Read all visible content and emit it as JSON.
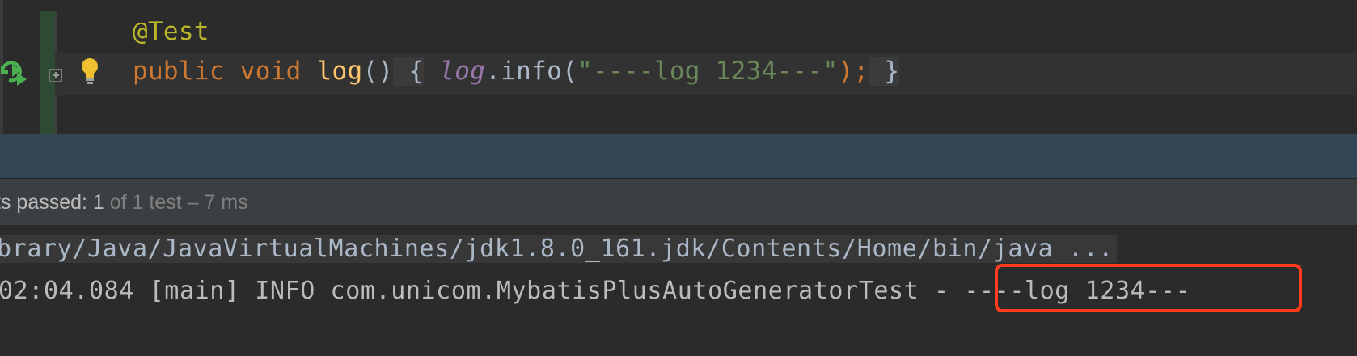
{
  "editor": {
    "annotation": "@Test",
    "method": {
      "kw_public": "public",
      "kw_void": "void",
      "name": "log",
      "parens": "()",
      "open_brace": " {",
      "log_field": "log",
      "call": ".info(",
      "string": "\"----log 1234---\"",
      "close": ");",
      "close_brace": " }"
    }
  },
  "status": {
    "passed_prefix": "ts passed: 1",
    "passed_suffix": " of 1 test – 7 ms"
  },
  "console": {
    "line1": "brary/Java/JavaVirtualMachines/jdk1.8.0_161.jdk/Contents/Home/bin/java ...",
    "line2": "02:04.084 [main] INFO com.unicom.MybatisPlusAutoGeneratorTest - ----log 1234---"
  },
  "colors": {
    "highlight_box": "#ff3b1e",
    "run_icon": "#4caf50",
    "bulb_icon": "#f0c030"
  },
  "icons": [
    "run-test-icon",
    "fold-icon",
    "intention-bulb-icon"
  ]
}
